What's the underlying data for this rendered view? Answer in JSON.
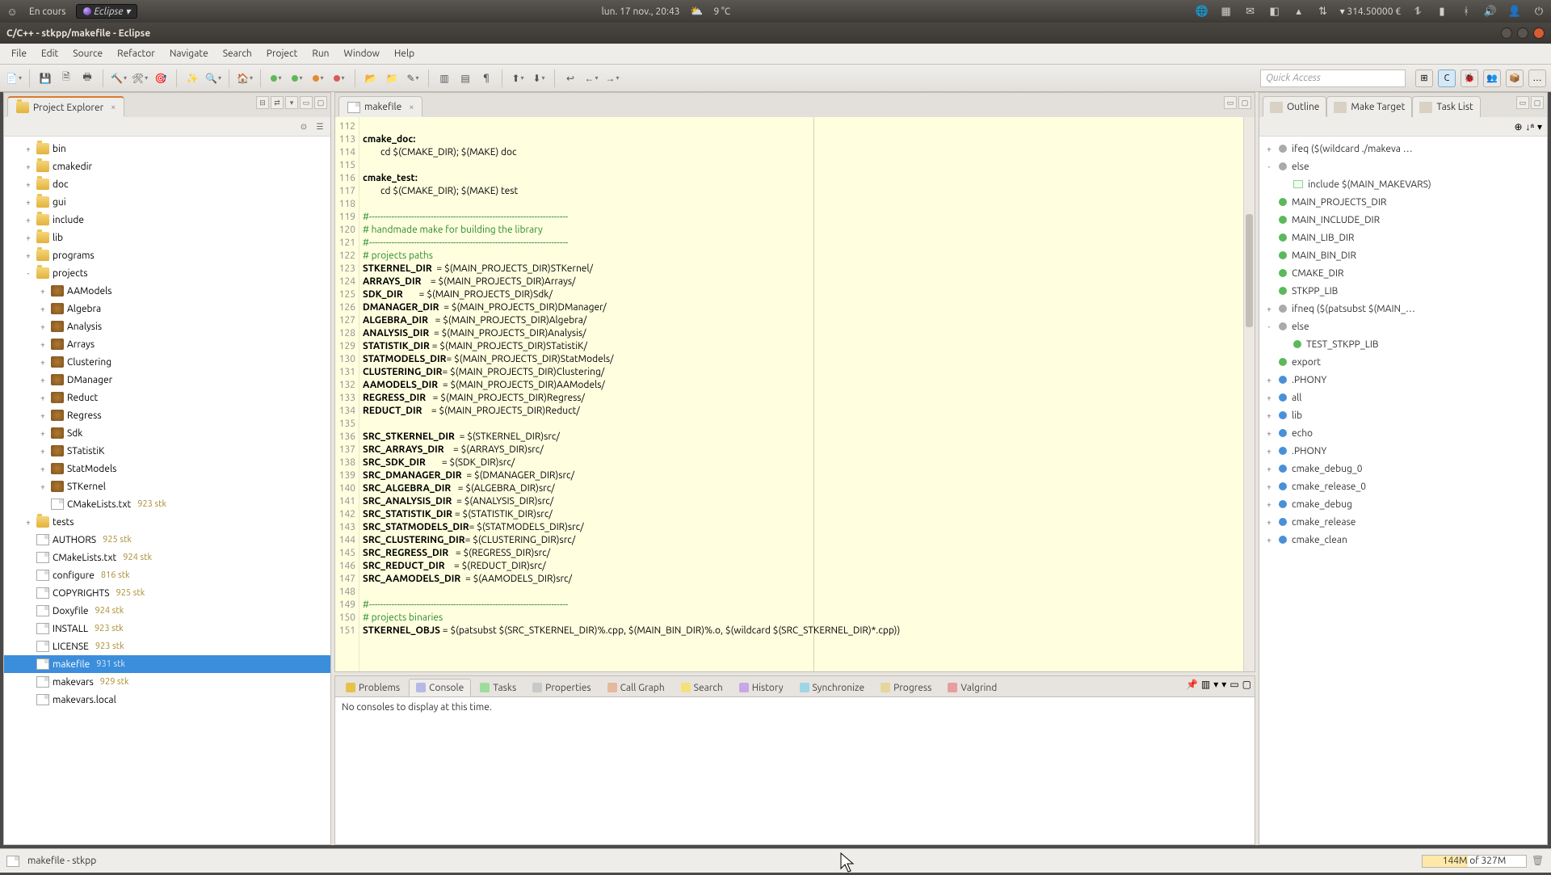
{
  "system_panel": {
    "encours": "En cours",
    "eclipse": "Eclipse ▾",
    "datetime": "lun. 17 nov., 20:43",
    "temp": "9 °C",
    "power": "▾ 314.50000 €"
  },
  "window": {
    "title": "C/C++ - stkpp/makefile - Eclipse"
  },
  "menu": [
    "File",
    "Edit",
    "Source",
    "Refactor",
    "Navigate",
    "Search",
    "Project",
    "Run",
    "Window",
    "Help"
  ],
  "quick_access_placeholder": "Quick Access",
  "explorer": {
    "title": "Project Explorer",
    "tree": [
      {
        "ind": 1,
        "exp": "+",
        "icon": "folder",
        "label": "bin"
      },
      {
        "ind": 1,
        "exp": "+",
        "icon": "folder",
        "label": "cmakedir"
      },
      {
        "ind": 1,
        "exp": "+",
        "icon": "folder",
        "label": "doc"
      },
      {
        "ind": 1,
        "exp": "+",
        "icon": "folder",
        "label": "gui"
      },
      {
        "ind": 1,
        "exp": "+",
        "icon": "folder",
        "label": "include"
      },
      {
        "ind": 1,
        "exp": "+",
        "icon": "folder",
        "label": "lib"
      },
      {
        "ind": 1,
        "exp": "+",
        "icon": "folder",
        "label": "programs"
      },
      {
        "ind": 1,
        "exp": "-",
        "icon": "folder",
        "label": "projects"
      },
      {
        "ind": 2,
        "exp": "+",
        "icon": "pkg",
        "label": "AAModels"
      },
      {
        "ind": 2,
        "exp": "+",
        "icon": "pkg",
        "label": "Algebra"
      },
      {
        "ind": 2,
        "exp": "+",
        "icon": "pkg",
        "label": "Analysis"
      },
      {
        "ind": 2,
        "exp": "+",
        "icon": "pkg",
        "label": "Arrays"
      },
      {
        "ind": 2,
        "exp": "+",
        "icon": "pkg",
        "label": "Clustering"
      },
      {
        "ind": 2,
        "exp": "+",
        "icon": "pkg",
        "label": "DManager"
      },
      {
        "ind": 2,
        "exp": "+",
        "icon": "pkg",
        "label": "Reduct"
      },
      {
        "ind": 2,
        "exp": "+",
        "icon": "pkg",
        "label": "Regress"
      },
      {
        "ind": 2,
        "exp": "+",
        "icon": "pkg",
        "label": "Sdk"
      },
      {
        "ind": 2,
        "exp": "+",
        "icon": "pkg",
        "label": "STatistiK"
      },
      {
        "ind": 2,
        "exp": "+",
        "icon": "pkg",
        "label": "StatModels"
      },
      {
        "ind": 2,
        "exp": "+",
        "icon": "pkg",
        "label": "STKernel"
      },
      {
        "ind": 2,
        "exp": "",
        "icon": "file",
        "label": "CMakeLists.txt",
        "rev": "923  stk"
      },
      {
        "ind": 1,
        "exp": "+",
        "icon": "folder",
        "label": "tests"
      },
      {
        "ind": 1,
        "exp": "",
        "icon": "file",
        "label": "AUTHORS",
        "rev": "925  stk"
      },
      {
        "ind": 1,
        "exp": "",
        "icon": "file",
        "label": "CMakeLists.txt",
        "rev": "924  stk"
      },
      {
        "ind": 1,
        "exp": "",
        "icon": "file",
        "label": "configure",
        "rev": "816  stk"
      },
      {
        "ind": 1,
        "exp": "",
        "icon": "file",
        "label": "COPYRIGHTS",
        "rev": "925  stk"
      },
      {
        "ind": 1,
        "exp": "",
        "icon": "file",
        "label": "Doxyfile",
        "rev": "924  stk"
      },
      {
        "ind": 1,
        "exp": "",
        "icon": "file",
        "label": "INSTALL",
        "rev": "923  stk"
      },
      {
        "ind": 1,
        "exp": "",
        "icon": "file",
        "label": "LICENSE",
        "rev": "923  stk"
      },
      {
        "ind": 1,
        "exp": "",
        "icon": "file",
        "label": "makefile",
        "rev": "931  stk",
        "sel": true
      },
      {
        "ind": 1,
        "exp": "",
        "icon": "file",
        "label": "makevars",
        "rev": "929  stk"
      },
      {
        "ind": 1,
        "exp": "",
        "icon": "file",
        "label": "makevars.local"
      }
    ]
  },
  "editor": {
    "tab": "makefile",
    "first_line": 112,
    "lines": [
      {
        "t": ""
      },
      {
        "t": "cmake_doc:",
        "cls": "tok-target"
      },
      {
        "t": "\tcd $(CMAKE_DIR); $(MAKE) doc"
      },
      {
        "t": ""
      },
      {
        "t": "cmake_test:",
        "cls": "tok-target"
      },
      {
        "t": "\tcd $(CMAKE_DIR); $(MAKE) test"
      },
      {
        "t": ""
      },
      {
        "t": "#-----------------------------------------------------------------------",
        "cls": "tok-comment"
      },
      {
        "t": "# handmade make for building the library",
        "cls": "tok-comment"
      },
      {
        "t": "#-----------------------------------------------------------------------",
        "cls": "tok-comment"
      },
      {
        "t": "# projects paths",
        "cls": "tok-comment"
      },
      {
        "seg": [
          {
            "s": "STKERNEL_DIR  ",
            "c": "tok-var"
          },
          {
            "s": "= $(MAIN_PROJECTS_DIR)STKernel/"
          }
        ]
      },
      {
        "seg": [
          {
            "s": "ARRAYS_DIR    ",
            "c": "tok-var"
          },
          {
            "s": "= $(MAIN_PROJECTS_DIR)Arrays/"
          }
        ]
      },
      {
        "seg": [
          {
            "s": "SDK_DIR       ",
            "c": "tok-var"
          },
          {
            "s": "= $(MAIN_PROJECTS_DIR)Sdk/"
          }
        ]
      },
      {
        "seg": [
          {
            "s": "DMANAGER_DIR  ",
            "c": "tok-var"
          },
          {
            "s": "= $(MAIN_PROJECTS_DIR)DManager/"
          }
        ]
      },
      {
        "seg": [
          {
            "s": "ALGEBRA_DIR   ",
            "c": "tok-var"
          },
          {
            "s": "= $(MAIN_PROJECTS_DIR)Algebra/"
          }
        ]
      },
      {
        "seg": [
          {
            "s": "ANALYSIS_DIR  ",
            "c": "tok-var"
          },
          {
            "s": "= $(MAIN_PROJECTS_DIR)Analysis/"
          }
        ]
      },
      {
        "seg": [
          {
            "s": "STATISTIK_DIR ",
            "c": "tok-var"
          },
          {
            "s": "= $(MAIN_PROJECTS_DIR)STatistiK/"
          }
        ]
      },
      {
        "seg": [
          {
            "s": "STATMODELS_DIR",
            "c": "tok-var"
          },
          {
            "s": "= $(MAIN_PROJECTS_DIR)StatModels/"
          }
        ]
      },
      {
        "seg": [
          {
            "s": "CLUSTERING_DIR",
            "c": "tok-var"
          },
          {
            "s": "= $(MAIN_PROJECTS_DIR)Clustering/"
          }
        ]
      },
      {
        "seg": [
          {
            "s": "AAMODELS_DIR  ",
            "c": "tok-var"
          },
          {
            "s": "= $(MAIN_PROJECTS_DIR)AAModels/"
          }
        ]
      },
      {
        "seg": [
          {
            "s": "REGRESS_DIR   ",
            "c": "tok-var"
          },
          {
            "s": "= $(MAIN_PROJECTS_DIR)Regress/"
          }
        ]
      },
      {
        "seg": [
          {
            "s": "REDUCT_DIR    ",
            "c": "tok-var"
          },
          {
            "s": "= $(MAIN_PROJECTS_DIR)Reduct/"
          }
        ]
      },
      {
        "t": ""
      },
      {
        "seg": [
          {
            "s": "SRC_STKERNEL_DIR  ",
            "c": "tok-var"
          },
          {
            "s": "= $(STKERNEL_DIR)src/"
          }
        ]
      },
      {
        "seg": [
          {
            "s": "SRC_ARRAYS_DIR    ",
            "c": "tok-var"
          },
          {
            "s": "= $(ARRAYS_DIR)src/"
          }
        ]
      },
      {
        "seg": [
          {
            "s": "SRC_SDK_DIR       ",
            "c": "tok-var"
          },
          {
            "s": "= $(SDK_DIR)src/"
          }
        ]
      },
      {
        "seg": [
          {
            "s": "SRC_DMANAGER_DIR  ",
            "c": "tok-var"
          },
          {
            "s": "= $(DMANAGER_DIR)src/"
          }
        ]
      },
      {
        "seg": [
          {
            "s": "SRC_ALGEBRA_DIR   ",
            "c": "tok-var"
          },
          {
            "s": "= $(ALGEBRA_DIR)src/"
          }
        ]
      },
      {
        "seg": [
          {
            "s": "SRC_ANALYSIS_DIR  ",
            "c": "tok-var"
          },
          {
            "s": "= $(ANALYSIS_DIR)src/"
          }
        ]
      },
      {
        "seg": [
          {
            "s": "SRC_STATISTIK_DIR ",
            "c": "tok-var"
          },
          {
            "s": "= $(STATISTIK_DIR)src/"
          }
        ]
      },
      {
        "seg": [
          {
            "s": "SRC_STATMODELS_DIR",
            "c": "tok-var"
          },
          {
            "s": "= $(STATMODELS_DIR)src/"
          }
        ]
      },
      {
        "seg": [
          {
            "s": "SRC_CLUSTERING_DIR",
            "c": "tok-var"
          },
          {
            "s": "= $(CLUSTERING_DIR)src/"
          }
        ]
      },
      {
        "seg": [
          {
            "s": "SRC_REGRESS_DIR   ",
            "c": "tok-var"
          },
          {
            "s": "= $(REGRESS_DIR)src/"
          }
        ]
      },
      {
        "seg": [
          {
            "s": "SRC_REDUCT_DIR    ",
            "c": "tok-var"
          },
          {
            "s": "= $(REDUCT_DIR)src/"
          }
        ]
      },
      {
        "seg": [
          {
            "s": "SRC_AAMODELS_DIR  ",
            "c": "tok-var"
          },
          {
            "s": "= $(AAMODELS_DIR)src/"
          }
        ]
      },
      {
        "t": ""
      },
      {
        "t": "#-----------------------------------------------------------------------",
        "cls": "tok-comment"
      },
      {
        "t": "# projects binaries",
        "cls": "tok-comment"
      },
      {
        "seg": [
          {
            "s": "STKERNEL_OBJS ",
            "c": "tok-var"
          },
          {
            "s": "= $(patsubst $(SRC_STKERNEL_DIR)%.cpp, $(MAIN_BIN_DIR)%.o, $(wildcard $(SRC_STKERNEL_DIR)*.cpp))"
          }
        ]
      }
    ]
  },
  "bottom": {
    "tabs": [
      "Problems",
      "Console",
      "Tasks",
      "Properties",
      "Call Graph",
      "Search",
      "History",
      "Synchronize",
      "Progress",
      "Valgrind"
    ],
    "active": 1,
    "icons": [
      "ti-prob",
      "ti-cons",
      "ti-task",
      "ti-prop",
      "ti-call",
      "ti-search",
      "ti-hist",
      "ti-sync",
      "ti-prog",
      "ti-valg"
    ],
    "message": "No consoles to display at this time."
  },
  "outline": {
    "tabs": [
      "Outline",
      "Make Target",
      "Task List"
    ],
    "items": [
      {
        "ind": 0,
        "exp": "+",
        "b": "gray",
        "label": "ifeq ($(wildcard ./makeva …"
      },
      {
        "ind": 0,
        "exp": "-",
        "b": "gray",
        "label": "else"
      },
      {
        "ind": 1,
        "exp": "",
        "b": "",
        "label": "include $(MAIN_MAKEVARS)",
        "include": true
      },
      {
        "ind": 0,
        "exp": "",
        "b": "green",
        "label": "MAIN_PROJECTS_DIR"
      },
      {
        "ind": 0,
        "exp": "",
        "b": "green",
        "label": "MAIN_INCLUDE_DIR"
      },
      {
        "ind": 0,
        "exp": "",
        "b": "green",
        "label": "MAIN_LIB_DIR"
      },
      {
        "ind": 0,
        "exp": "",
        "b": "green",
        "label": "MAIN_BIN_DIR"
      },
      {
        "ind": 0,
        "exp": "",
        "b": "green",
        "label": "CMAKE_DIR"
      },
      {
        "ind": 0,
        "exp": "",
        "b": "green",
        "label": "STKPP_LIB"
      },
      {
        "ind": 0,
        "exp": "+",
        "b": "gray",
        "label": "ifneq ($(patsubst $(MAIN_…"
      },
      {
        "ind": 0,
        "exp": "-",
        "b": "gray",
        "label": "else"
      },
      {
        "ind": 1,
        "exp": "",
        "b": "green",
        "label": "TEST_STKPP_LIB"
      },
      {
        "ind": 0,
        "exp": "",
        "b": "green",
        "label": "export"
      },
      {
        "ind": 0,
        "exp": "+",
        "b": "blue",
        "label": ".PHONY"
      },
      {
        "ind": 0,
        "exp": "+",
        "b": "blue",
        "label": "all"
      },
      {
        "ind": 0,
        "exp": "+",
        "b": "blue",
        "label": "lib"
      },
      {
        "ind": 0,
        "exp": "+",
        "b": "blue",
        "label": "echo"
      },
      {
        "ind": 0,
        "exp": "+",
        "b": "blue",
        "label": ".PHONY"
      },
      {
        "ind": 0,
        "exp": "+",
        "b": "blue",
        "label": "cmake_debug_0"
      },
      {
        "ind": 0,
        "exp": "+",
        "b": "blue",
        "label": "cmake_release_0"
      },
      {
        "ind": 0,
        "exp": "+",
        "b": "blue",
        "label": "cmake_debug"
      },
      {
        "ind": 0,
        "exp": "+",
        "b": "blue",
        "label": "cmake_release"
      },
      {
        "ind": 0,
        "exp": "+",
        "b": "blue",
        "label": "cmake_clean"
      }
    ]
  },
  "status": {
    "left_icon_label": "makefile - stkpp",
    "heap": "144M of 327M"
  }
}
